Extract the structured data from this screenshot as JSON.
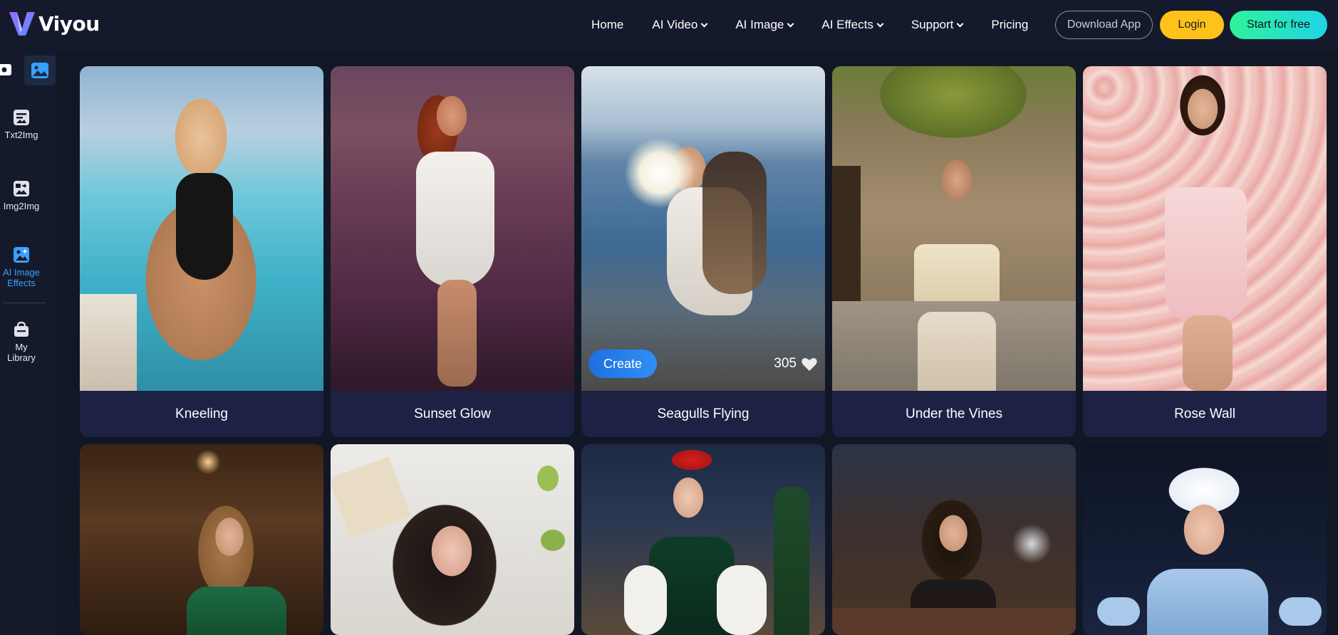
{
  "brand": {
    "name": "Viyou"
  },
  "nav": {
    "items": [
      {
        "label": "Home",
        "dropdown": false
      },
      {
        "label": "AI Video",
        "dropdown": true
      },
      {
        "label": "AI Image",
        "dropdown": true
      },
      {
        "label": "AI Effects",
        "dropdown": true
      },
      {
        "label": "Support",
        "dropdown": true
      },
      {
        "label": "Pricing",
        "dropdown": false
      }
    ],
    "download_label": "Download App",
    "login_label": "Login",
    "start_label": "Start for free"
  },
  "sidebar": {
    "items": [
      {
        "label": "Txt2Img",
        "icon": "txt2img-icon",
        "active": false
      },
      {
        "label": "Img2Img",
        "icon": "img2img-icon",
        "active": false
      },
      {
        "label": "AI Image Effects",
        "icon": "ai-image-effects-icon",
        "active": true
      },
      {
        "label": "My Library",
        "icon": "library-icon",
        "active": false
      }
    ]
  },
  "cards": [
    {
      "title": "Kneeling"
    },
    {
      "title": "Sunset Glow"
    },
    {
      "title": "Seagulls Flying",
      "create_label": "Create",
      "likes": "305"
    },
    {
      "title": "Under the Vines"
    },
    {
      "title": "Rose Wall"
    }
  ],
  "colors": {
    "accent": "#3aa0ff",
    "login": "#ffc21a",
    "start_gradient_from": "#2ff29a",
    "start_gradient_to": "#1fd4e6",
    "card_bg": "#1d2143"
  }
}
